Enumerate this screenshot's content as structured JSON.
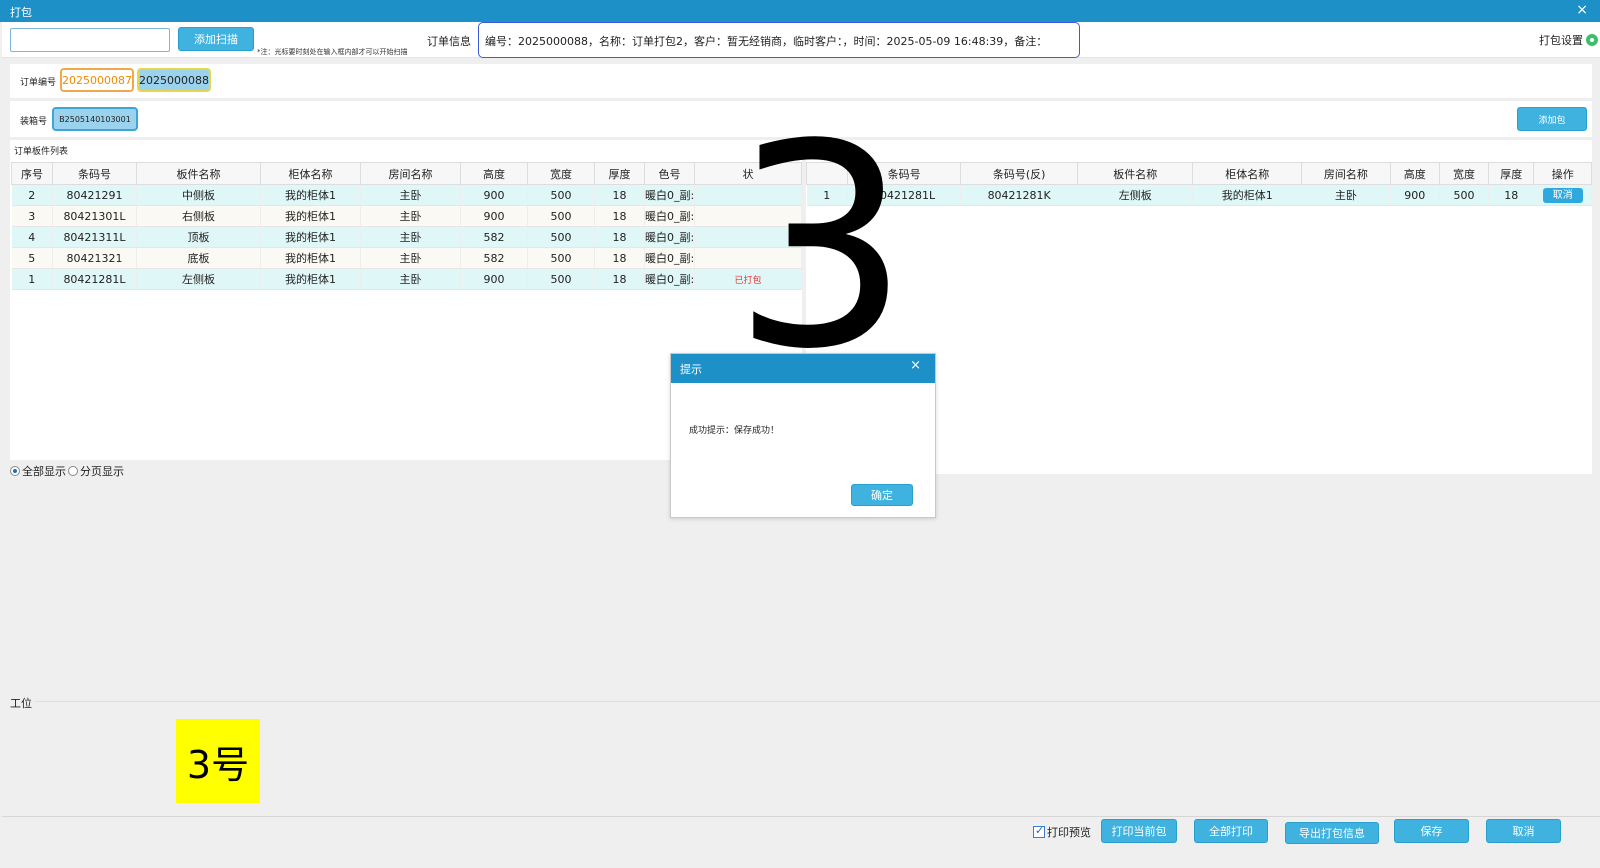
{
  "window": {
    "title": "打包",
    "close_icon": "×"
  },
  "topbar": {
    "scan_value": "",
    "scan_button": "添加扫描",
    "scan_note": "*注：光标要时刻处在输入框内部才可以开始扫描",
    "order_info_label": "订单信息",
    "order_info_text": "编号：2025000088，名称：订单打包2，客户：暂无经销商，临时客户：，时间：2025-05-09 16:48:39，备注：",
    "settings_label": "打包设置"
  },
  "order_select": {
    "label": "订单编号",
    "orders": [
      "2025000087",
      "2025000088"
    ]
  },
  "box": {
    "label": "装箱号",
    "box_no": "B2505140103001",
    "add_box_button": "添加包"
  },
  "left_table": {
    "title": "订单板件列表",
    "columns": [
      "序号",
      "条码号",
      "板件名称",
      "柜体名称",
      "房间名称",
      "高度",
      "宽度",
      "厚度",
      "色号",
      "状"
    ],
    "rows": [
      [
        "2",
        "80421291",
        "中侧板",
        "我的柜体1",
        "主卧",
        "900",
        "500",
        "18",
        "暖白0_副:",
        ""
      ],
      [
        "3",
        "80421301L",
        "右侧板",
        "我的柜体1",
        "主卧",
        "900",
        "500",
        "18",
        "暖白0_副:",
        ""
      ],
      [
        "4",
        "80421311L",
        "顶板",
        "我的柜体1",
        "主卧",
        "582",
        "500",
        "18",
        "暖白0_副:",
        ""
      ],
      [
        "5",
        "80421321",
        "底板",
        "我的柜体1",
        "主卧",
        "582",
        "500",
        "18",
        "暖白0_副:",
        ""
      ],
      [
        "1",
        "80421281L",
        "左侧板",
        "我的柜体1",
        "主卧",
        "900",
        "500",
        "18",
        "暖白0_副:",
        "已打包"
      ]
    ]
  },
  "right_table": {
    "title": "板件列表",
    "columns": [
      "",
      "条码号",
      "条码号(反)",
      "板件名称",
      "柜体名称",
      "房间名称",
      "高度",
      "宽度",
      "厚度",
      "操作"
    ],
    "rows": [
      [
        "1",
        "80421281L",
        "80421281K",
        "左侧板",
        "我的柜体1",
        "主卧",
        "900",
        "500",
        "18",
        "取消"
      ]
    ]
  },
  "display_mode": {
    "all": "全部显示",
    "paged": "分页显示"
  },
  "overlay_digit": "3",
  "station": {
    "label": "工位",
    "tile": "3号"
  },
  "bottom": {
    "print_preview": "打印预览",
    "buttons": [
      "打印当前包",
      "全部打印",
      "导出打包信息",
      "保存",
      "取消"
    ]
  },
  "dialog": {
    "title": "提示",
    "close_icon": "×",
    "message": "成功提示：保存成功！",
    "ok": "确定"
  }
}
